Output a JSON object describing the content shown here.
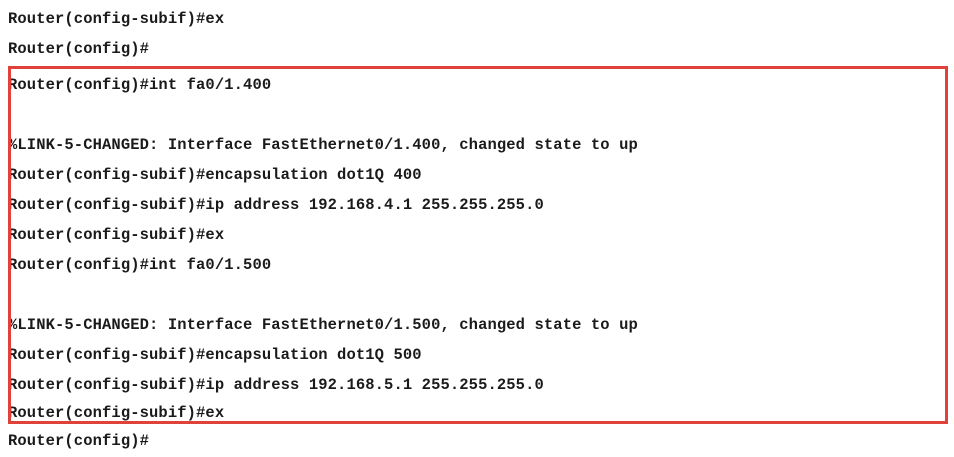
{
  "terminal": {
    "lines": [
      "Router(config-subif)#ex",
      "Router(config)#",
      "Router(config)#int fa0/1.400",
      "",
      "%LINK-5-CHANGED: Interface FastEthernet0/1.400, changed state to up",
      "Router(config-subif)#encapsulation dot1Q 400",
      "Router(config-subif)#ip address 192.168.4.1 255.255.255.0",
      "Router(config-subif)#ex",
      "Router(config)#int fa0/1.500",
      "",
      "%LINK-5-CHANGED: Interface FastEthernet0/1.500, changed state to up",
      "Router(config-subif)#encapsulation dot1Q 500",
      "Router(config-subif)#ip address 192.168.5.1 255.255.255.0",
      "Router(config-subif)#ex",
      "Router(config)#"
    ]
  },
  "colors": {
    "highlight_border": "#e0413a",
    "text": "#1a1a1a",
    "background": "#ffffff"
  }
}
